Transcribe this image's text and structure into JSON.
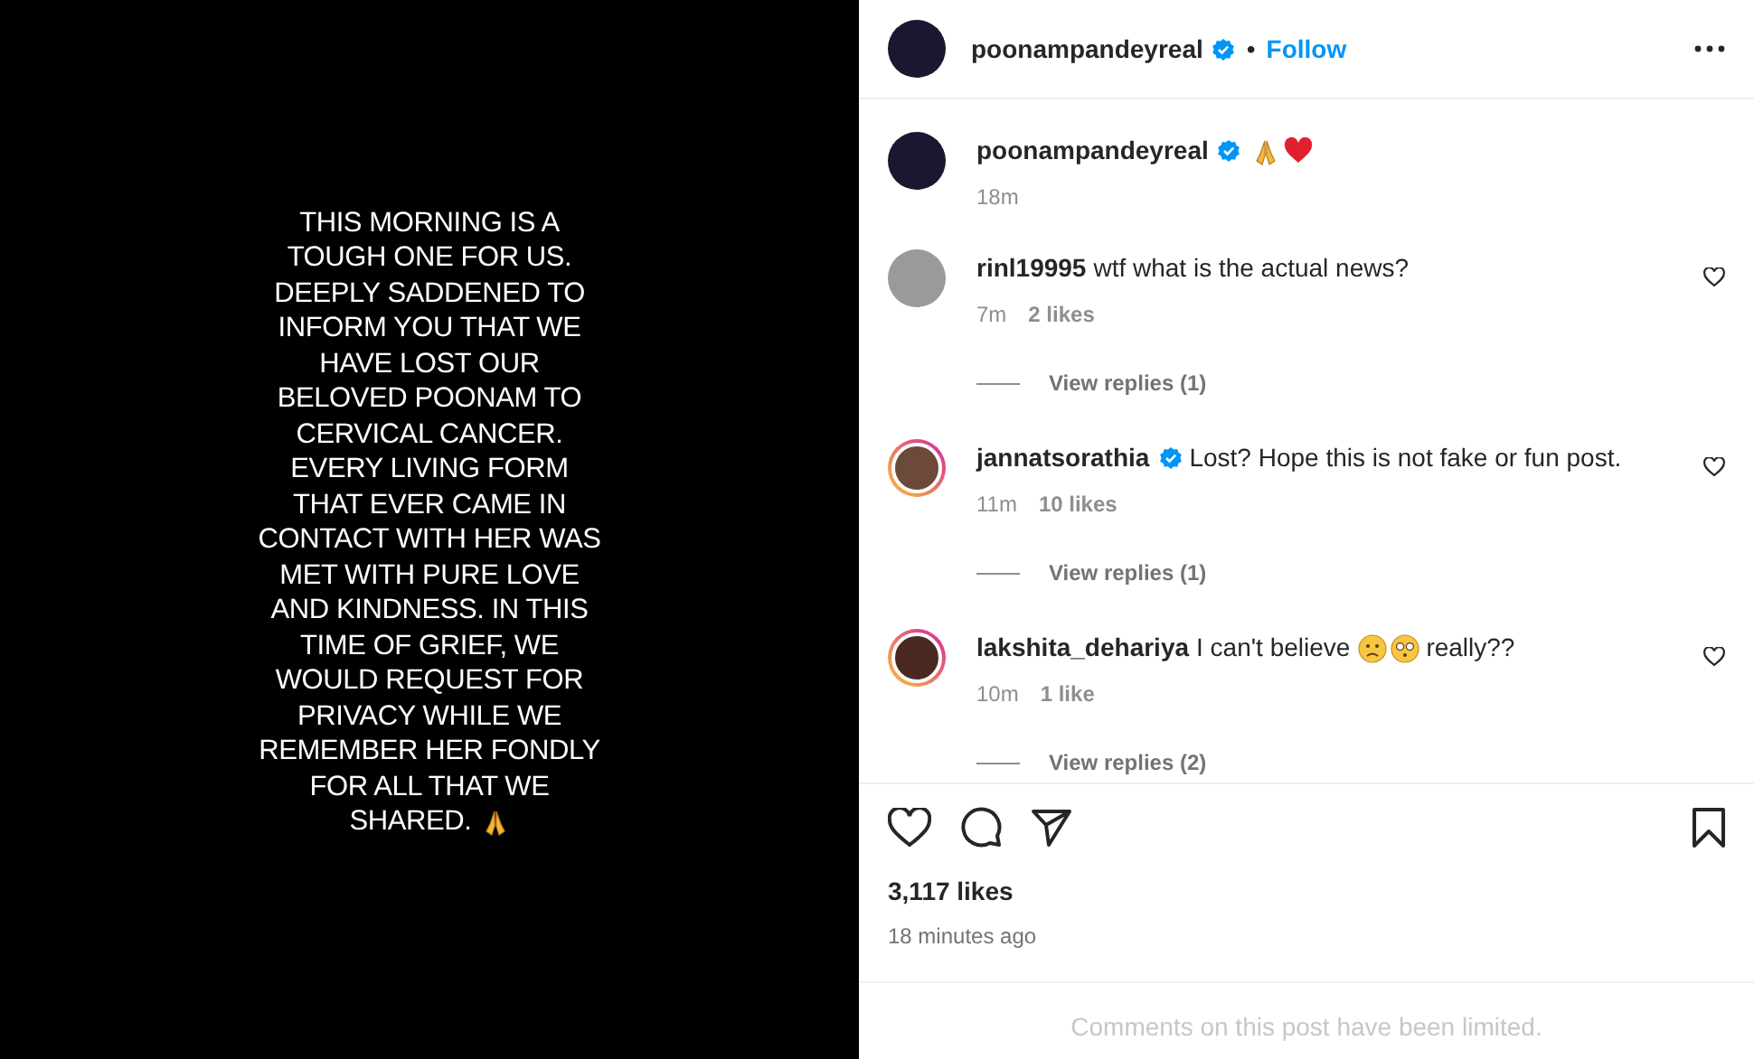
{
  "post_image": {
    "lines": [
      {
        "kind": "plain",
        "text": "THIS MORNING IS A"
      },
      {
        "kind": "plain",
        "text": "TOUGH ONE FOR US."
      },
      {
        "kind": "plain",
        "text": "DEEPLY SADDENED TO"
      },
      {
        "kind": "plain",
        "text": "INFORM YOU THAT WE"
      },
      {
        "kind": "plain",
        "text": "HAVE LOST OUR"
      },
      {
        "kind": "plain",
        "text": "BELOVED POONAM TO"
      },
      {
        "kind": "plain",
        "text": "CERVICAL CANCER."
      },
      {
        "kind": "plain",
        "text": "EVERY LIVING FORM"
      },
      {
        "kind": "plain",
        "text": "THAT EVER CAME IN"
      },
      {
        "kind": "plain",
        "text": "CONTACT WITH HER WAS"
      },
      {
        "kind": "plain",
        "text": "MET WITH PURE LOVE"
      },
      {
        "kind": "plain",
        "text": "AND KINDNESS. IN THIS"
      },
      {
        "kind": "plain",
        "text": "TIME OF GRIEF, WE"
      },
      {
        "kind": "plain",
        "text": "WOULD REQUEST FOR"
      },
      {
        "kind": "plain",
        "text": "PRIVACY WHILE WE"
      },
      {
        "kind": "plain",
        "text": "REMEMBER HER FONDLY"
      },
      {
        "kind": "plain",
        "text": "FOR ALL THAT WE"
      },
      {
        "kind": "pray",
        "text": "SHARED."
      }
    ]
  },
  "header": {
    "username": "poonampandeyreal",
    "verified": true,
    "separator": "•",
    "follow": "Follow"
  },
  "caption": {
    "username": "poonampandeyreal",
    "verified": true,
    "segments": [
      {
        "kind": "pray"
      },
      {
        "kind": "heart"
      }
    ],
    "time": "18m"
  },
  "comments": [
    {
      "username": "rinl19995",
      "verified": false,
      "ring": false,
      "segments": [
        {
          "kind": "text",
          "text": "wtf what is the actual news?"
        }
      ],
      "time": "7m",
      "likes": "2 likes",
      "replies": "View replies (1)"
    },
    {
      "username": "jannatsorathia",
      "verified": true,
      "ring": true,
      "segments": [
        {
          "kind": "text",
          "text": "Lost? Hope this is not fake or fun post."
        }
      ],
      "time": "11m",
      "likes": "10 likes",
      "replies": "View replies (1)"
    },
    {
      "username": "lakshita_dehariya",
      "verified": false,
      "ring": true,
      "segments": [
        {
          "kind": "text",
          "text": "I can't believe"
        },
        {
          "kind": "sad"
        },
        {
          "kind": "flushed"
        },
        {
          "kind": "text",
          "text": "really??"
        }
      ],
      "time": "10m",
      "likes": "1 like",
      "replies": "View replies (2)"
    }
  ],
  "likes": "3,117 likes",
  "posted": "18 minutes ago",
  "footer": "Comments on this post have been limited."
}
